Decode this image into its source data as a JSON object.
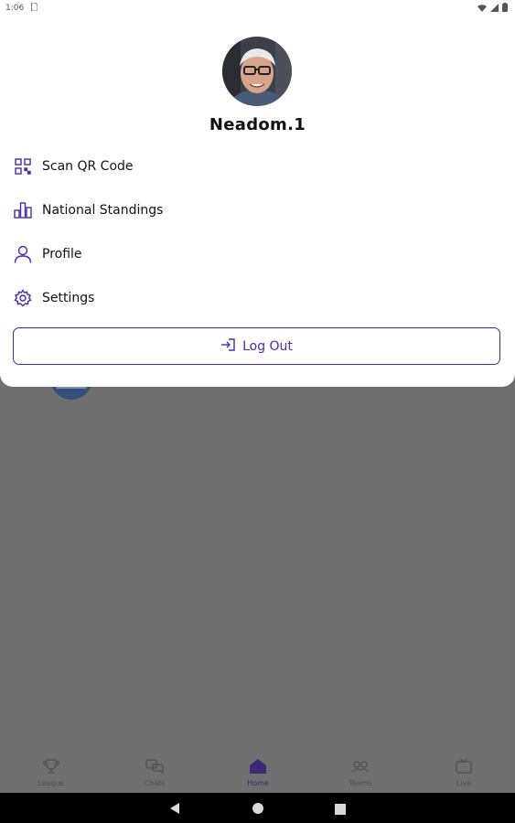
{
  "status_bar": {
    "time": "1:06",
    "sim_icon": "sim-card-icon",
    "icons": [
      "wifi-icon",
      "signal-icon",
      "battery-icon"
    ]
  },
  "profile": {
    "username": "Neadom.1",
    "avatar": "user-avatar-photo"
  },
  "menu": {
    "items": [
      {
        "label": "Scan QR Code",
        "icon": "qr-code-icon"
      },
      {
        "label": "National Standings",
        "icon": "bar-chart-icon"
      },
      {
        "label": "Profile",
        "icon": "person-icon"
      },
      {
        "label": "Settings",
        "icon": "gear-icon"
      }
    ],
    "logout_label": "Log Out",
    "logout_icon": "logout-icon"
  },
  "bottom_nav": {
    "active": "Home",
    "items": [
      {
        "label": "League",
        "icon": "trophy-icon"
      },
      {
        "label": "Chats",
        "icon": "chat-icon"
      },
      {
        "label": "Home",
        "icon": "home-icon"
      },
      {
        "label": "Teams",
        "icon": "teams-icon"
      },
      {
        "label": "Live",
        "icon": "tv-icon"
      }
    ]
  },
  "colors": {
    "accent": "#4b2aad",
    "overlay": "#6f6f6f",
    "text": "#111111"
  }
}
